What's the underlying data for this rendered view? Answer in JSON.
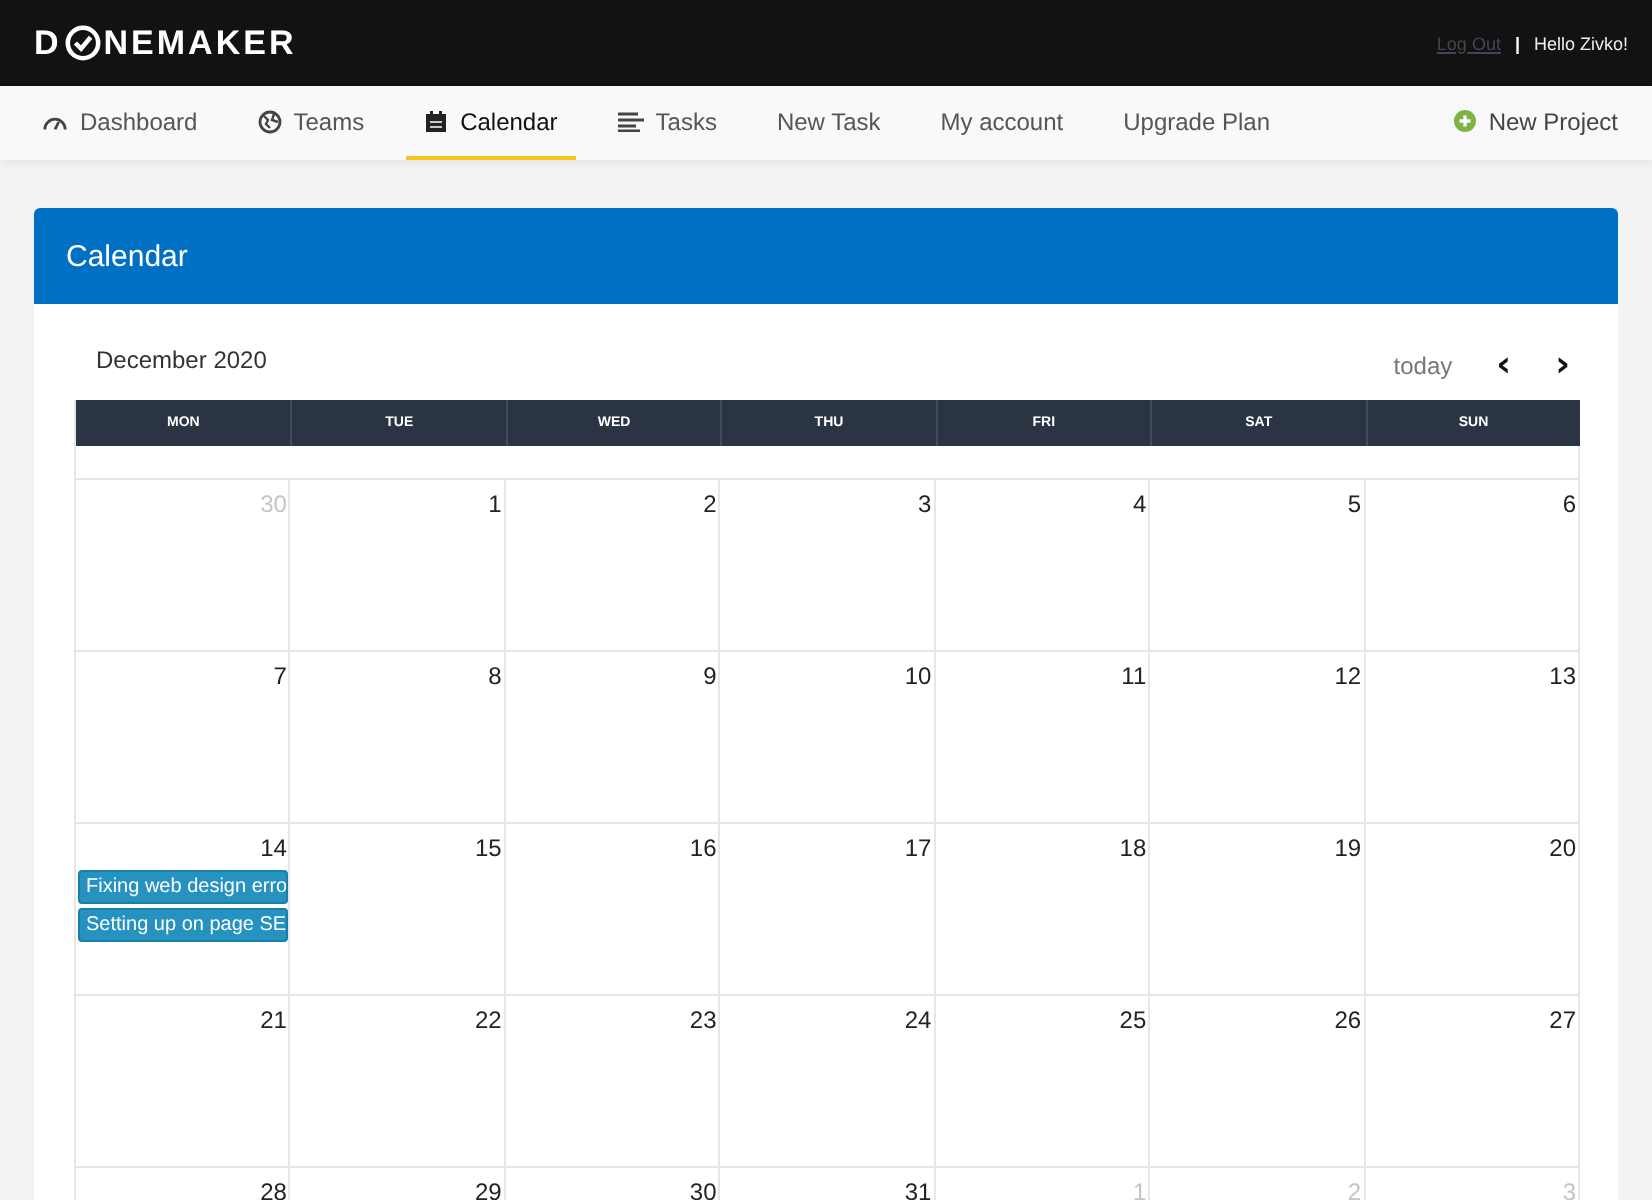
{
  "brand": {
    "before": "D",
    "after": "NEMAKER"
  },
  "user": {
    "logout": "Log Out",
    "separator": "|",
    "greeting": "Hello Zivko!"
  },
  "nav": [
    {
      "label": "Dashboard",
      "selected": false
    },
    {
      "label": "Teams",
      "selected": false
    },
    {
      "label": "Calendar",
      "selected": true
    },
    {
      "label": "Tasks",
      "selected": false
    },
    {
      "label": "New Task",
      "selected": false
    },
    {
      "label": "My account",
      "selected": false
    },
    {
      "label": "Upgrade Plan",
      "selected": false
    }
  ],
  "new_project": "New Project",
  "card": {
    "title": "Calendar"
  },
  "calendar": {
    "month": "December 2020",
    "today": "today",
    "prev": "‹",
    "next": "›",
    "weekdays": [
      "MON",
      "TUE",
      "WED",
      "THU",
      "FRI",
      "SAT",
      "SUN"
    ],
    "weeks": [
      [
        {
          "day": "30",
          "outside": true
        },
        {
          "day": "1",
          "outside": false
        },
        {
          "day": "2",
          "outside": false
        },
        {
          "day": "3",
          "outside": false
        },
        {
          "day": "4",
          "outside": false
        },
        {
          "day": "5",
          "outside": false
        },
        {
          "day": "6",
          "outside": false
        }
      ],
      [
        {
          "day": "7",
          "outside": false
        },
        {
          "day": "8",
          "outside": false
        },
        {
          "day": "9",
          "outside": false
        },
        {
          "day": "10",
          "outside": false
        },
        {
          "day": "11",
          "outside": false
        },
        {
          "day": "12",
          "outside": false
        },
        {
          "day": "13",
          "outside": false
        }
      ],
      [
        {
          "day": "14",
          "outside": false,
          "events": [
            "Fixing web design erro",
            "Setting up on page SE"
          ]
        },
        {
          "day": "15",
          "outside": false
        },
        {
          "day": "16",
          "outside": false
        },
        {
          "day": "17",
          "outside": false
        },
        {
          "day": "18",
          "outside": false
        },
        {
          "day": "19",
          "outside": false
        },
        {
          "day": "20",
          "outside": false
        }
      ],
      [
        {
          "day": "21",
          "outside": false
        },
        {
          "day": "22",
          "outside": false
        },
        {
          "day": "23",
          "outside": false
        },
        {
          "day": "24",
          "outside": false
        },
        {
          "day": "25",
          "outside": false
        },
        {
          "day": "26",
          "outside": false
        },
        {
          "day": "27",
          "outside": false
        }
      ],
      [
        {
          "day": "28",
          "outside": false
        },
        {
          "day": "29",
          "outside": false
        },
        {
          "day": "30",
          "outside": false
        },
        {
          "day": "31",
          "outside": false
        },
        {
          "day": "1",
          "outside": true
        },
        {
          "day": "2",
          "outside": true
        },
        {
          "day": "3",
          "outside": true
        }
      ]
    ]
  }
}
